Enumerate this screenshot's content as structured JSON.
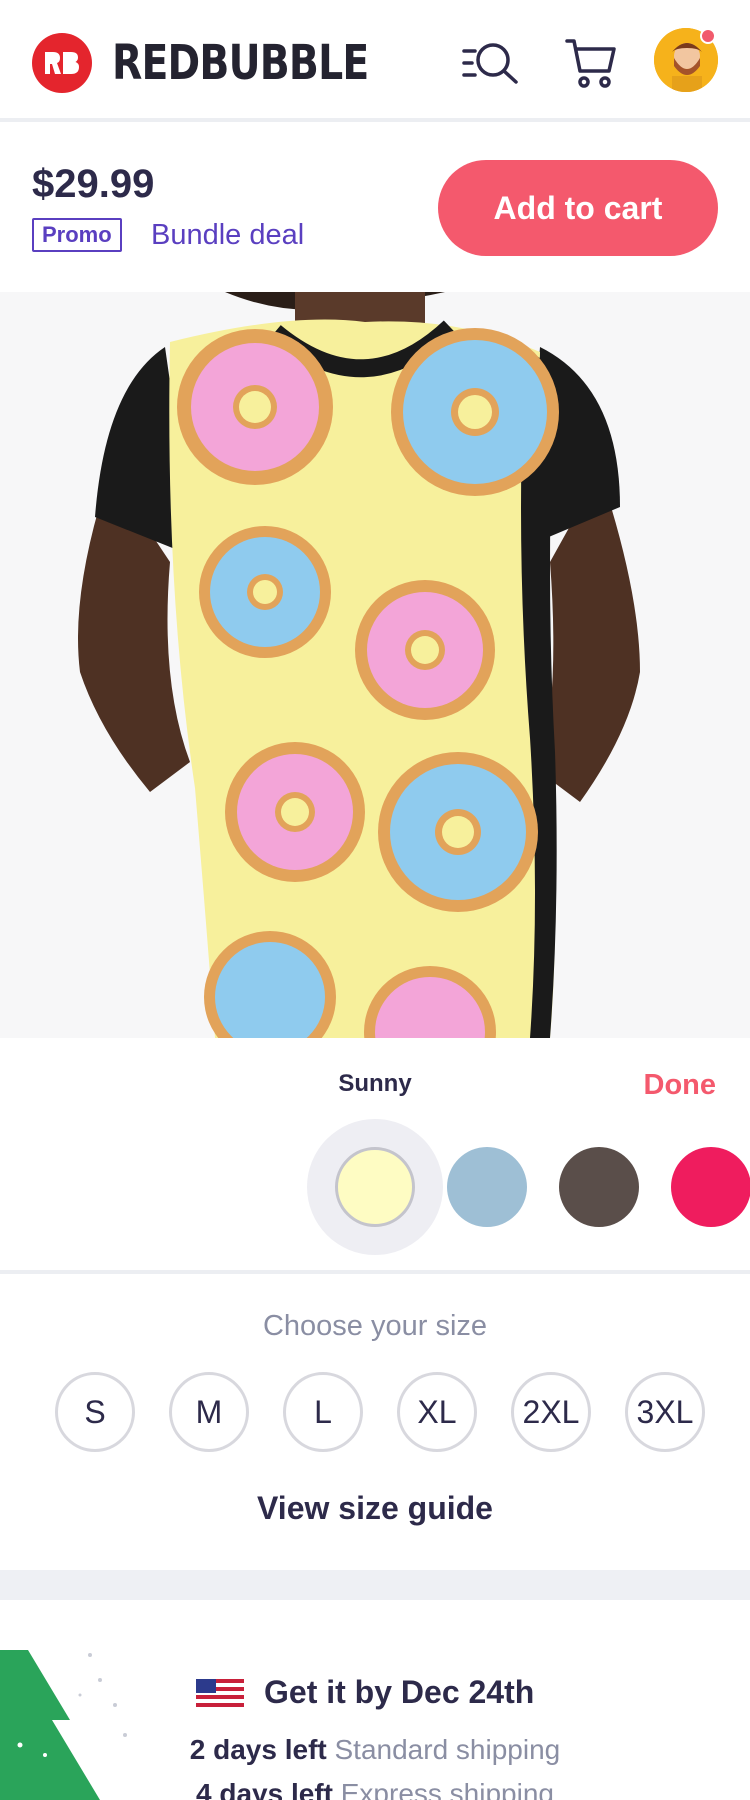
{
  "header": {
    "brand": "REDBUBBLE",
    "icons": [
      "search-icon",
      "cart-icon",
      "avatar"
    ]
  },
  "pricebar": {
    "price": "$29.99",
    "promo_badge": "Promo",
    "bundle_deal": "Bundle deal",
    "add_to_cart": "Add to cart"
  },
  "color_picker": {
    "selected_name": "Sunny",
    "done_label": "Done",
    "swatches": [
      "#fefcc3",
      "#9ebfd5",
      "#5a4e4a",
      "#ef1c5e"
    ]
  },
  "size_picker": {
    "title": "Choose your size",
    "sizes": [
      "S",
      "M",
      "L",
      "XL",
      "2XL",
      "3XL"
    ],
    "guide_link": "View size guide"
  },
  "shipping": {
    "title": "Get it by Dec 24th",
    "standard_days": "2 days left",
    "standard_label": "Standard shipping",
    "express_days": "4 days left",
    "express_label": "Express shipping"
  },
  "colors": {
    "accent": "#f4596d",
    "brand_red": "#e4252d",
    "purple": "#5a3fc0",
    "text_dark": "#2d2a4a",
    "text_muted": "#8a8ea3"
  }
}
